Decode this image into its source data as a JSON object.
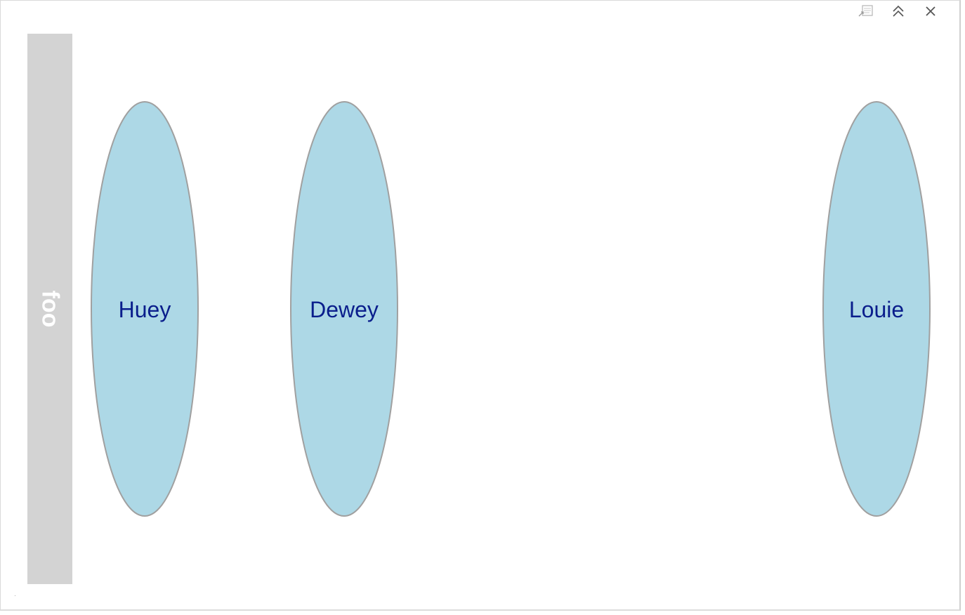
{
  "lane": {
    "label": "foo",
    "color": "#d3d3d3",
    "label_color": "#ffffff"
  },
  "nodes": [
    {
      "label": "Huey"
    },
    {
      "label": "Dewey"
    },
    {
      "label": "Louie"
    }
  ],
  "node_style": {
    "fill": "#add8e6",
    "stroke": "#a0a0a0",
    "text_color": "#0a1e8c"
  },
  "toolbar": {
    "icons": [
      "export-icon",
      "collapse-up-icon",
      "close-icon"
    ]
  }
}
